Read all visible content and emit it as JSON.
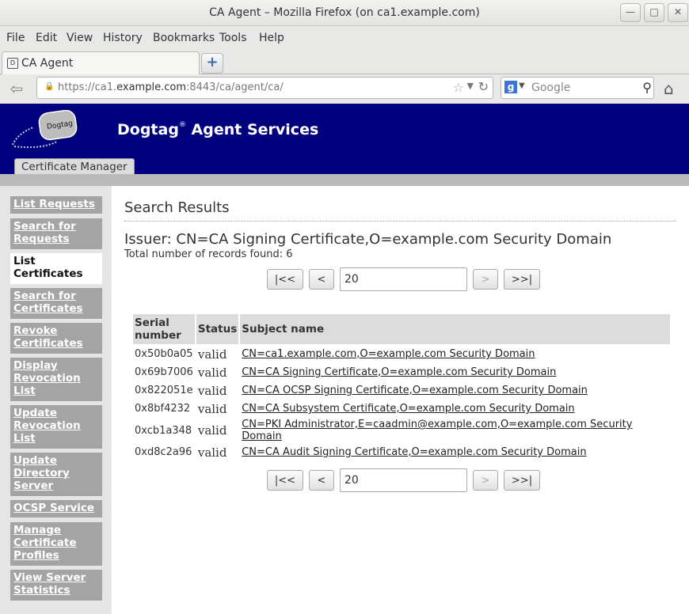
{
  "window": {
    "title": "CA Agent – Mozilla Firefox (on ca1.example.com)",
    "minimize_icon": "minimize-icon",
    "maximize_icon": "maximize-icon",
    "close_icon": "close-icon"
  },
  "menu": [
    "File",
    "Edit",
    "View",
    "History",
    "Bookmarks",
    "Tools",
    "Help"
  ],
  "tab": {
    "label": "CA Agent"
  },
  "navbar": {
    "url_prefix": "https://ca1.",
    "url_host": "example.com",
    "url_suffix": ":8443/ca/agent/ca/",
    "search_placeholder": "Google"
  },
  "header": {
    "brand": "Dogtag",
    "brand_mark": "®",
    "brand_rest": " Agent Services",
    "logo_text": "Dogtag",
    "tab": "Certificate Manager",
    "bg_color": "#00007f"
  },
  "sidebar": {
    "items": [
      {
        "label": "List Requests",
        "active": false
      },
      {
        "label": "Search for Requests",
        "active": false
      },
      {
        "label": "List Certificates",
        "active": true
      },
      {
        "label": "Search for Certificates",
        "active": false
      },
      {
        "label": "Revoke Certificates",
        "active": false
      },
      {
        "label": "Display Revocation List",
        "active": false
      },
      {
        "label": "Update Revocation List",
        "active": false
      },
      {
        "label": "Update Directory Server",
        "active": false
      },
      {
        "label": "OCSP Service",
        "active": false
      },
      {
        "label": "Manage Certificate Profiles",
        "active": false
      },
      {
        "label": "View Server Statistics",
        "active": false
      }
    ]
  },
  "main": {
    "title": "Search Results",
    "issuer": "Issuer: CN=CA Signing Certificate,O=example.com Security Domain",
    "total": "Total number of records found: 6",
    "pager": {
      "first": "|<<",
      "prev": "<",
      "count": "20",
      "next": ">",
      "last": ">>|"
    },
    "table": {
      "headers": [
        "Serial number",
        "Status",
        "Subject name"
      ],
      "rows": [
        {
          "serial": "0x50b0a05",
          "status": "valid",
          "subject": "CN=ca1.example.com,O=example.com Security Domain"
        },
        {
          "serial": "0x69b7006",
          "status": "valid",
          "subject": "CN=CA Signing Certificate,O=example.com Security Domain"
        },
        {
          "serial": "0x822051e",
          "status": "valid",
          "subject": "CN=CA OCSP Signing Certificate,O=example.com Security Domain"
        },
        {
          "serial": "0x8bf4232",
          "status": "valid",
          "subject": "CN=CA Subsystem Certificate,O=example.com Security Domain"
        },
        {
          "serial": "0xcb1a348",
          "status": "valid",
          "subject": "CN=PKI Administrator,E=caadmin@example.com,O=example.com Security Domain"
        },
        {
          "serial": "0xd8c2a96",
          "status": "valid",
          "subject": "CN=CA Audit Signing Certificate,O=example.com Security Domain"
        }
      ]
    }
  }
}
